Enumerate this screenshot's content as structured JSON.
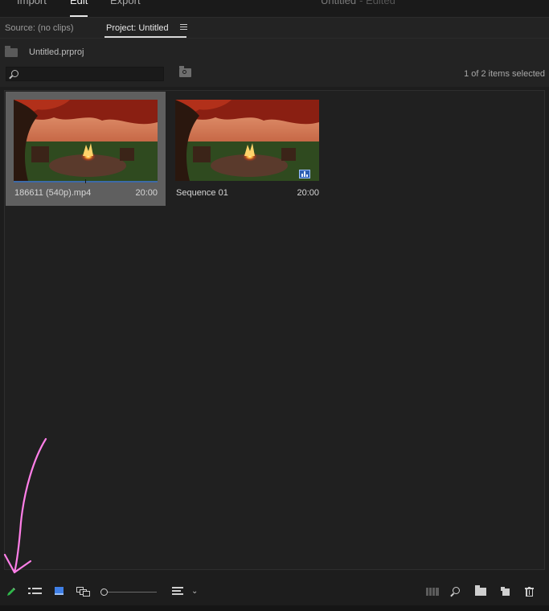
{
  "topnav": {
    "import": "Import",
    "edit": "Edit",
    "export": "Export",
    "title": "Untitled",
    "edited": "- Edited"
  },
  "panel": {
    "source_tab": "Source: (no clips)",
    "project_tab": "Project: Untitled"
  },
  "project": {
    "file": "Untitled.prproj",
    "search_placeholder": "",
    "selection": "1 of 2 items selected"
  },
  "items": [
    {
      "name": "186611 (540p).mp4",
      "duration": "20:00",
      "selected": true
    },
    {
      "name": "Sequence 01",
      "duration": "20:00",
      "selected": false
    }
  ],
  "icons": {
    "write_on": "pencil-icon",
    "list_view": "list-view-icon",
    "icon_view": "icon-view-icon",
    "freeform": "freeform-view-icon",
    "sort": "sort-icons-icon",
    "automate": "automate-to-sequence-icon",
    "find": "find-icon",
    "new_bin": "new-bin-icon",
    "new_item": "new-item-icon",
    "clear": "trash-icon"
  },
  "colors": {
    "accent": "#3f7fe6",
    "annotation": "#ff7fe8",
    "pencil": "#2fb84a"
  }
}
